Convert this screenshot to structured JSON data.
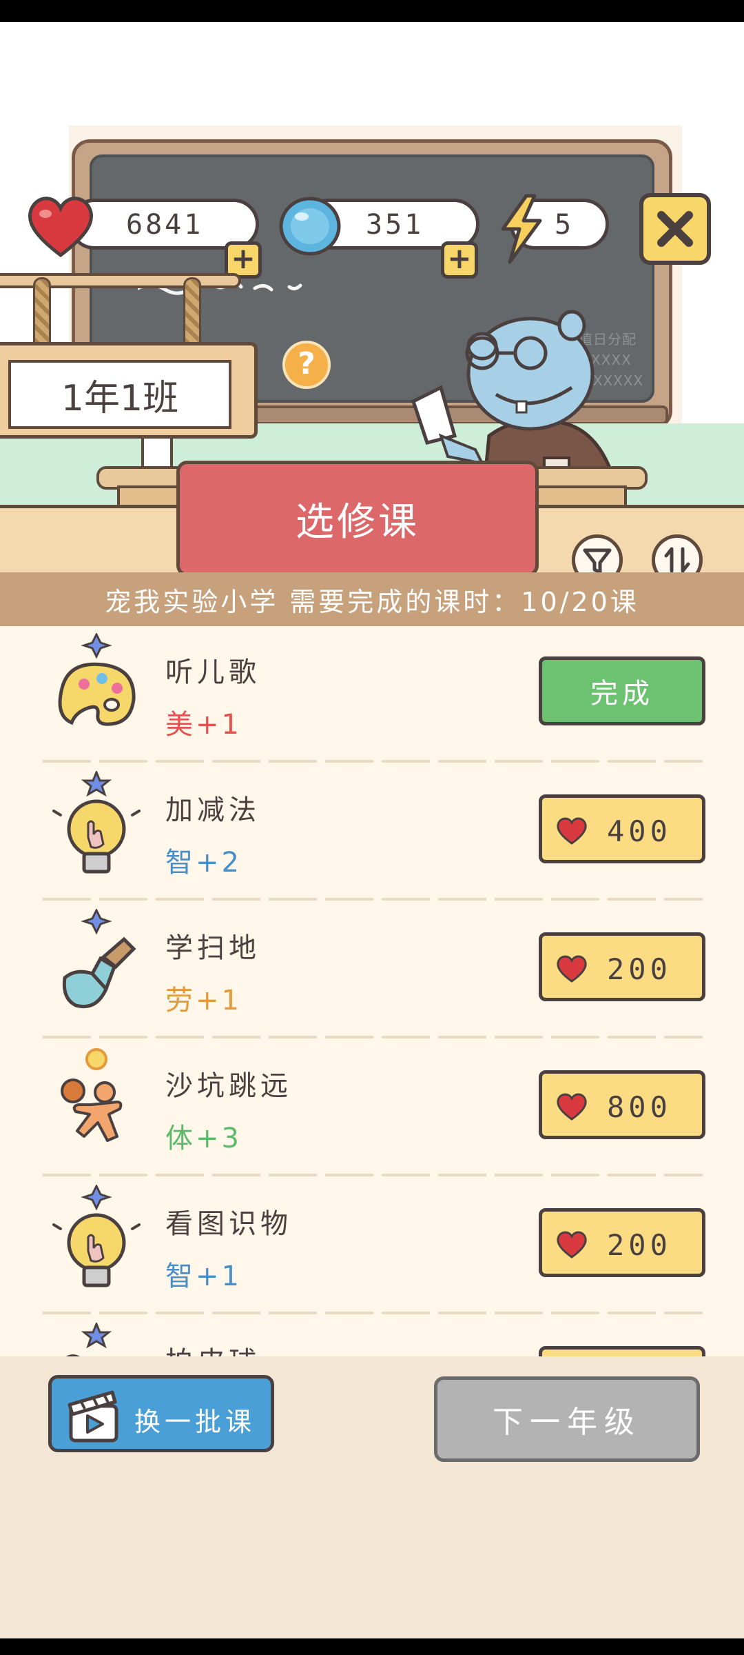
{
  "stats": {
    "hearts": "6841",
    "gems": "351",
    "energy": "5"
  },
  "classroom": {
    "class_name": "1年1班",
    "board_note_line1": "值日分配",
    "board_note_line2": "XXXX",
    "board_note_line3": "XXXXXX"
  },
  "header": {
    "title": "选修课",
    "school_line": "宠我实验小学 需要完成的课时：10/20课"
  },
  "courses": [
    {
      "name": "听儿歌",
      "gain": "美+1",
      "gain_color": "#e2524f",
      "action": "完成",
      "icon": "palette-icon"
    },
    {
      "name": "加减法",
      "gain": "智+2",
      "gain_color": "#4a8ec8",
      "price": "400",
      "icon": "lightbulb-icon"
    },
    {
      "name": "学扫地",
      "gain": "劳+1",
      "gain_color": "#e49a3a",
      "price": "200",
      "icon": "shovel-icon"
    },
    {
      "name": "沙坑跳远",
      "gain": "体+3",
      "gain_color": "#5cba6a",
      "price": "800",
      "icon": "jumping-kid-icon"
    },
    {
      "name": "看图识物",
      "gain": "智+1",
      "gain_color": "#4a8ec8",
      "price": "200",
      "icon": "lightbulb-icon"
    },
    {
      "name": "拍皮球",
      "gain": "",
      "gain_color": "#5cba6a",
      "price": "",
      "icon": "ball-icon"
    }
  ],
  "bottom": {
    "swap_label": "换一批课",
    "next_label": "下一年级"
  },
  "colors": {
    "banner": "#dd686a",
    "price_button": "#fcdc83",
    "done_button": "#6cc271",
    "swap_button": "#4a9fd6",
    "next_button_disabled": "#b3b3b3"
  }
}
